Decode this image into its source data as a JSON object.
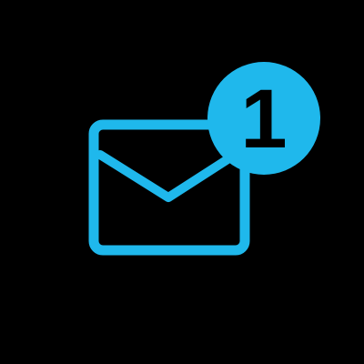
{
  "notification": {
    "icon": "envelope-icon",
    "count": "1"
  },
  "colors": {
    "background": "#000000",
    "accent": "#1fb8ec",
    "badge_text": "#000000"
  }
}
